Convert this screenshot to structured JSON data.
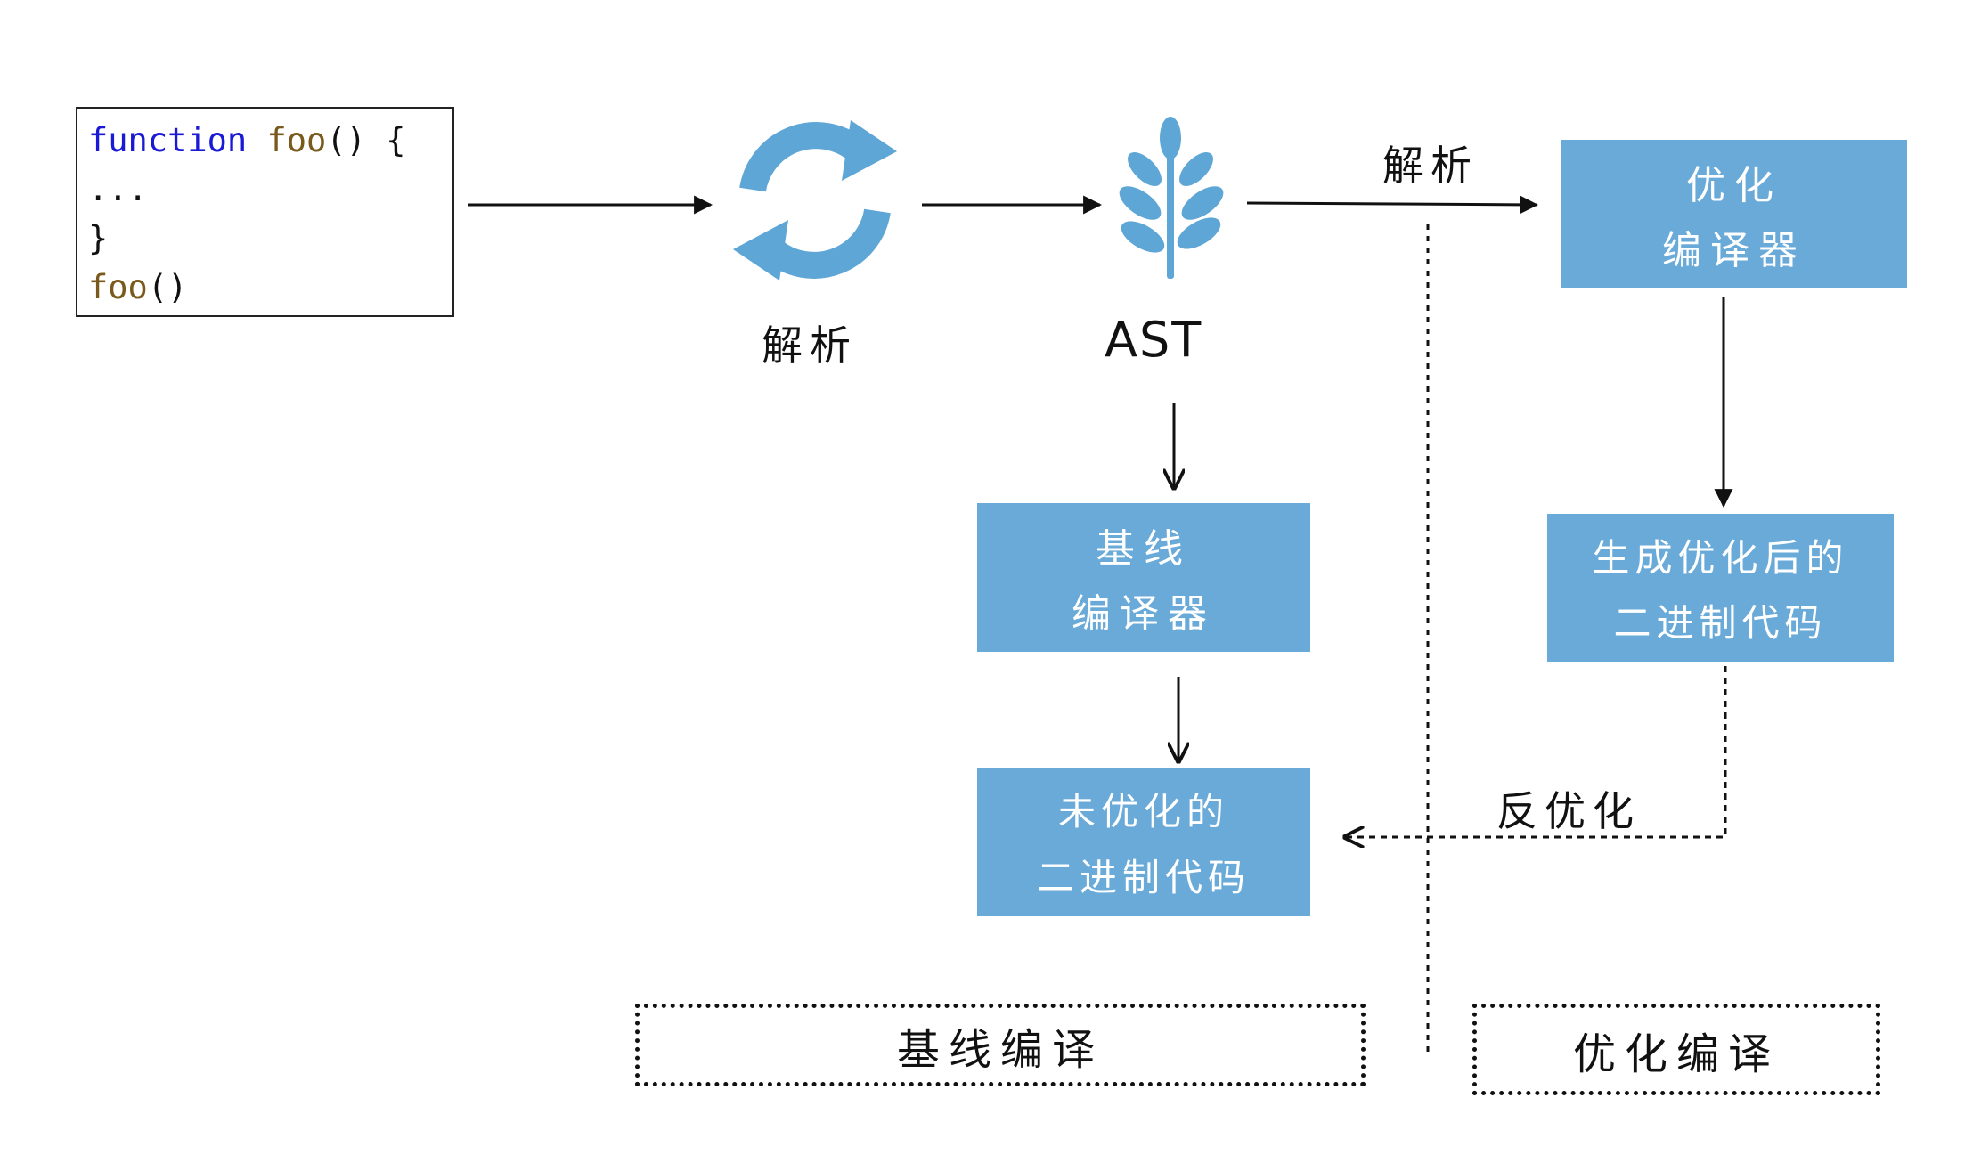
{
  "code": {
    "line1_keyword": "function",
    "line1_name": "foo",
    "line1_rest": "() {",
    "line2": "...",
    "line3": "}",
    "line4_name": "foo",
    "line4_rest": "()"
  },
  "labels": {
    "parse": "解析",
    "ast": "AST",
    "parse_arrow": "解析",
    "deopt": "反优化"
  },
  "boxes": {
    "optimizing_compiler": [
      "优化",
      "编译器"
    ],
    "baseline_compiler": [
      "基线",
      "编译器"
    ],
    "optimized_binary": [
      "生成优化后的",
      "二进制代码"
    ],
    "unoptimized_binary": [
      "未优化的",
      "二进制代码"
    ]
  },
  "sections": {
    "baseline": "基线编译",
    "optimizing": "优化编译"
  },
  "colors": {
    "box_fill": "#6aaad8",
    "icon_fill": "#5ea6d6",
    "line": "#111111",
    "code_keyword": "#1a1ad6",
    "code_name": "#7a5a1c"
  },
  "icons": {
    "parser": "refresh-cycle-icon",
    "ast": "tree-sprout-icon"
  }
}
